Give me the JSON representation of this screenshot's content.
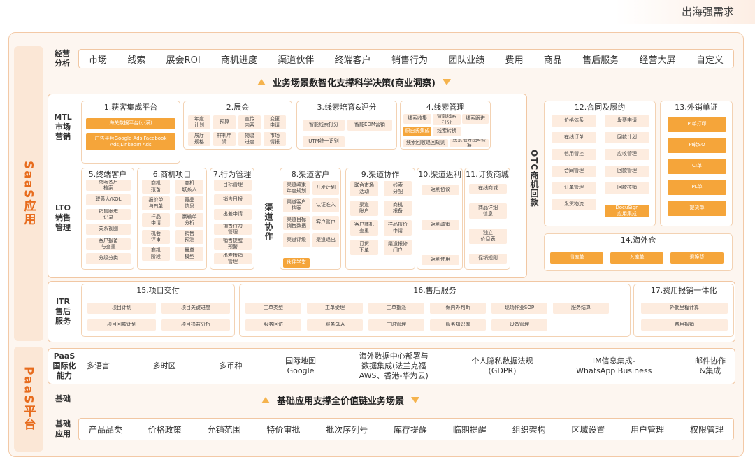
{
  "header": {
    "title": "出海强需求"
  },
  "bands": {
    "saas": "SaaS应用",
    "paas": "PaaS平台"
  },
  "analysis": {
    "label": "经营\n分析",
    "items": [
      "市场",
      "线索",
      "展会ROI",
      "商机进度",
      "渠道伙伴",
      "终端客户",
      "销售行为",
      "团队业绩",
      "费用",
      "商品",
      "售后服务",
      "经营大屏",
      "自定义"
    ],
    "banner": "业务场景数智化支撑科学决策(商业洞察)"
  },
  "row_labels": {
    "mtl": "MTL\n市场\n营销",
    "lto": "LTO\n销售\n管理",
    "itr": "ITR\n售后\n服务"
  },
  "channel_collab": "渠道协作",
  "otc_label": "OTC商机回款",
  "modules": {
    "m1": {
      "title": "1.获客集成平台",
      "c1": "海关数据平台(小满)",
      "c2": "广告平台Google Ads,Facebook\nAds,LinkedIn Ads"
    },
    "m2": {
      "title": "2.展会",
      "cells": [
        "年度\n计划",
        "预算",
        "宣传\n内容",
        "变更\n申请",
        "展厅\n规格",
        "样机申\n请",
        "物流\n进度",
        "市场\n情报"
      ]
    },
    "m3": {
      "title": "3.线索培育&评分",
      "cells": [
        "智能线索打分",
        "智能EDM营销",
        "UTM统一识别"
      ]
    },
    "m4": {
      "title": "4.线索管理",
      "cells": [
        "线索收集",
        "智能线索\n打分",
        "线索跟进",
        "多渠道\n线索集成",
        "线索转换",
        "线索回收退回规则",
        "线索池分配&公海"
      ],
      "special": "原自氏集成"
    },
    "m5": {
      "title": "5.终端客户",
      "cells": [
        "终端客户\n档案",
        "联系人/KOL",
        "销售跟进\n记录",
        "关系视图",
        "客户报备\n与查重",
        "分级分类"
      ]
    },
    "m6": {
      "title": "6.商机项目",
      "cells": [
        "商机\n报备",
        "商机\n联系人",
        "报价单\n与PI单",
        "竞品\n信息",
        "样品\n申请",
        "赢输单\n分析",
        "机会\n评审",
        "销售\n预测",
        "商机\n阶段",
        "赢单\n模型"
      ]
    },
    "m7": {
      "title": "7.行为管理",
      "cells": [
        "目标管理",
        "销售日报",
        "出差申请",
        "销售行为\n管理",
        "销售提醒\n预警",
        "出差报销\n管理"
      ]
    },
    "m8": {
      "title": "8.渠道客户",
      "cells": [
        "渠道政策\n年度规划",
        "开发计划",
        "渠道客户\n档案",
        "认证准入",
        "渠道目标\n销售数据",
        "客户账户",
        "渠道评级",
        "渠道退出",
        "伙伴学堂"
      ]
    },
    "m9": {
      "title": "9.渠道协作",
      "cells": [
        "联合市场\n活动",
        "线索\n分配",
        "渠道\n账户",
        "商机\n报备",
        "客户商机\n查重",
        "样品报价\n申请",
        "订货\n下单",
        "渠道报修\n门户"
      ]
    },
    "m10": {
      "title": "10.渠道返利",
      "cells": [
        "返利协议",
        "返利政策",
        "返利使用"
      ]
    },
    "m11": {
      "title": "11.订货商城",
      "cells": [
        "在线商城",
        "商品详细\n信息",
        "独立\n价目表",
        "促销规则"
      ]
    },
    "m12": {
      "title": "12.合同及履约",
      "cells": [
        "价格体系",
        "发票申请",
        "在线订单",
        "回款计划",
        "信用管控",
        "应收管理",
        "合同管理",
        "回款管理",
        "订单管理",
        "回款核销",
        "发货物流",
        "DocuSign\n应用集成"
      ]
    },
    "m13": {
      "title": "13.外销单证",
      "cells": [
        "PI单打印",
        "PI转SO",
        "CI单",
        "PL单",
        "提货单"
      ]
    },
    "m14": {
      "title": "14.海外仓",
      "cells": [
        "出库单",
        "入库单",
        "退换货"
      ]
    },
    "m15": {
      "title": "15.项目交付",
      "cells": [
        "项目计划",
        "项目关键进度",
        "项目回款计划",
        "项目损益分析"
      ]
    },
    "m16": {
      "title": "16.售后服务",
      "cells": [
        "工单类型",
        "工单受理",
        "工单指派",
        "保内外判断",
        "现场作业SOP",
        "服务结算",
        "服务回访",
        "服务SLA",
        "工时管理",
        "服务知识库",
        "设备管理"
      ]
    },
    "m17": {
      "title": "17.费用报销一体化",
      "cells": [
        "外勤里程计算",
        "费用报销"
      ]
    }
  },
  "paas": {
    "label": "PaaS\n国际化\n能力",
    "items": [
      "多语言",
      "多时区",
      "多币种",
      "国际地图\nGoogle",
      "海外数据中心部署与\n数据集成(法兰克福\nAWS、香港-华为云)",
      "个人隐私数据法规\n(GDPR)",
      "IM信息集成-\nWhatsApp Business",
      "邮件协作\n&集成"
    ]
  },
  "foundation": {
    "label": "基础",
    "banner": "基础应用支撑全价值链业务场景"
  },
  "base_apps": {
    "label": "基础\n应用",
    "items": [
      "产品品类",
      "价格政策",
      "允销范围",
      "特价审批",
      "批次序列号",
      "库存提醒",
      "临期提醒",
      "组织架构",
      "区域设置",
      "用户管理",
      "权限管理"
    ]
  }
}
